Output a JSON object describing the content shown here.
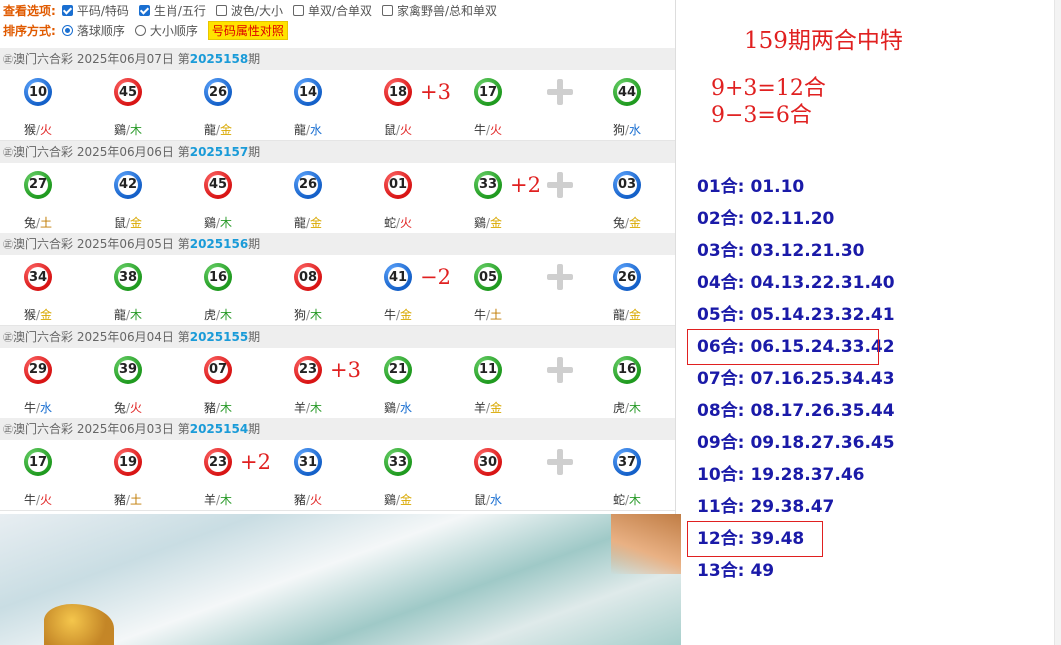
{
  "filters": {
    "view_label": "查看选项:",
    "view_options": [
      {
        "label": "平码/特码",
        "checked": true
      },
      {
        "label": "生肖/五行",
        "checked": true
      },
      {
        "label": "波色/大小",
        "checked": false
      },
      {
        "label": "单双/合单双",
        "checked": false
      },
      {
        "label": "家禽野兽/总和单双",
        "checked": false
      }
    ],
    "sort_label": "排序方式:",
    "sort_options": [
      {
        "label": "落球顺序",
        "selected": true
      },
      {
        "label": "大小顺序",
        "selected": false
      }
    ],
    "attr_button": "号码属性对照"
  },
  "draws": [
    {
      "prefix": "澳门六合彩 2025年06月07日 第",
      "issue": "2025158",
      "suffix": "期",
      "balls": [
        {
          "n": "10",
          "c": "blue"
        },
        {
          "n": "45",
          "c": "red"
        },
        {
          "n": "26",
          "c": "blue"
        },
        {
          "n": "14",
          "c": "blue"
        },
        {
          "n": "18",
          "c": "red"
        },
        {
          "n": "17",
          "c": "green"
        }
      ],
      "special": {
        "n": "44",
        "c": "green"
      },
      "zodiacs": [
        {
          "z": "猴",
          "e": "火",
          "t": "fire"
        },
        {
          "z": "鷄",
          "e": "木",
          "t": "wood"
        },
        {
          "z": "龍",
          "e": "金",
          "t": "gold"
        },
        {
          "z": "龍",
          "e": "水",
          "t": "water"
        },
        {
          "z": "鼠",
          "e": "火",
          "t": "fire"
        },
        {
          "z": "牛",
          "e": "火",
          "t": "fire"
        }
      ],
      "special_zodiac": {
        "z": "狗",
        "e": "水",
        "t": "water"
      },
      "annotation": {
        "text": "+3",
        "after": 4
      }
    },
    {
      "prefix": "澳门六合彩 2025年06月06日 第",
      "issue": "2025157",
      "suffix": "期",
      "balls": [
        {
          "n": "27",
          "c": "green"
        },
        {
          "n": "42",
          "c": "blue"
        },
        {
          "n": "45",
          "c": "red"
        },
        {
          "n": "26",
          "c": "blue"
        },
        {
          "n": "01",
          "c": "red"
        },
        {
          "n": "33",
          "c": "green"
        }
      ],
      "special": {
        "n": "03",
        "c": "blue"
      },
      "zodiacs": [
        {
          "z": "兔",
          "e": "土",
          "t": "earth"
        },
        {
          "z": "鼠",
          "e": "金",
          "t": "gold"
        },
        {
          "z": "鷄",
          "e": "木",
          "t": "wood"
        },
        {
          "z": "龍",
          "e": "金",
          "t": "gold"
        },
        {
          "z": "蛇",
          "e": "火",
          "t": "fire"
        },
        {
          "z": "鷄",
          "e": "金",
          "t": "gold"
        }
      ],
      "special_zodiac": {
        "z": "兔",
        "e": "金",
        "t": "gold"
      },
      "annotation": {
        "text": "+2",
        "after": 5
      }
    },
    {
      "prefix": "澳门六合彩 2025年06月05日 第",
      "issue": "2025156",
      "suffix": "期",
      "balls": [
        {
          "n": "34",
          "c": "red"
        },
        {
          "n": "38",
          "c": "green"
        },
        {
          "n": "16",
          "c": "green"
        },
        {
          "n": "08",
          "c": "red"
        },
        {
          "n": "41",
          "c": "blue"
        },
        {
          "n": "05",
          "c": "green"
        }
      ],
      "special": {
        "n": "26",
        "c": "blue"
      },
      "zodiacs": [
        {
          "z": "猴",
          "e": "金",
          "t": "gold"
        },
        {
          "z": "龍",
          "e": "木",
          "t": "wood"
        },
        {
          "z": "虎",
          "e": "木",
          "t": "wood"
        },
        {
          "z": "狗",
          "e": "木",
          "t": "wood"
        },
        {
          "z": "牛",
          "e": "金",
          "t": "gold"
        },
        {
          "z": "牛",
          "e": "土",
          "t": "earth"
        }
      ],
      "special_zodiac": {
        "z": "龍",
        "e": "金",
        "t": "gold"
      },
      "annotation": {
        "text": "−2",
        "after": 4
      }
    },
    {
      "prefix": "澳门六合彩 2025年06月04日 第",
      "issue": "2025155",
      "suffix": "期",
      "balls": [
        {
          "n": "29",
          "c": "red"
        },
        {
          "n": "39",
          "c": "green"
        },
        {
          "n": "07",
          "c": "red"
        },
        {
          "n": "23",
          "c": "red"
        },
        {
          "n": "21",
          "c": "green"
        },
        {
          "n": "11",
          "c": "green"
        }
      ],
      "special": {
        "n": "16",
        "c": "green"
      },
      "zodiacs": [
        {
          "z": "牛",
          "e": "水",
          "t": "water"
        },
        {
          "z": "兔",
          "e": "火",
          "t": "fire"
        },
        {
          "z": "豬",
          "e": "木",
          "t": "wood"
        },
        {
          "z": "羊",
          "e": "木",
          "t": "wood"
        },
        {
          "z": "鷄",
          "e": "水",
          "t": "water"
        },
        {
          "z": "羊",
          "e": "金",
          "t": "gold"
        }
      ],
      "special_zodiac": {
        "z": "虎",
        "e": "木",
        "t": "wood"
      },
      "annotation": {
        "text": "+3",
        "after": 3
      }
    },
    {
      "prefix": "澳门六合彩 2025年06月03日 第",
      "issue": "2025154",
      "suffix": "期",
      "balls": [
        {
          "n": "17",
          "c": "green"
        },
        {
          "n": "19",
          "c": "red"
        },
        {
          "n": "23",
          "c": "red"
        },
        {
          "n": "31",
          "c": "blue"
        },
        {
          "n": "33",
          "c": "green"
        },
        {
          "n": "30",
          "c": "red"
        }
      ],
      "special": {
        "n": "37",
        "c": "blue"
      },
      "zodiacs": [
        {
          "z": "牛",
          "e": "火",
          "t": "fire"
        },
        {
          "z": "豬",
          "e": "土",
          "t": "earth"
        },
        {
          "z": "羊",
          "e": "木",
          "t": "wood"
        },
        {
          "z": "豬",
          "e": "火",
          "t": "fire"
        },
        {
          "z": "鷄",
          "e": "金",
          "t": "gold"
        },
        {
          "z": "鼠",
          "e": "水",
          "t": "water"
        }
      ],
      "special_zodiac": {
        "z": "蛇",
        "e": "木",
        "t": "wood"
      },
      "annotation": {
        "text": "+2",
        "after": 2
      }
    }
  ],
  "side": {
    "title": "159期两合中特",
    "calc": [
      "9+3=12合",
      "9−3=6合"
    ],
    "he_list": [
      {
        "label": "01合:",
        "nums": "01.10",
        "boxed": false
      },
      {
        "label": "02合:",
        "nums": "02.11.20",
        "boxed": false
      },
      {
        "label": "03合:",
        "nums": "03.12.21.30",
        "boxed": false
      },
      {
        "label": "04合:",
        "nums": "04.13.22.31.40",
        "boxed": false
      },
      {
        "label": "05合:",
        "nums": "05.14.23.32.41",
        "boxed": false
      },
      {
        "label": "06合:",
        "nums": "06.15.24.33.42",
        "boxed": true
      },
      {
        "label": "07合:",
        "nums": "07.16.25.34.43",
        "boxed": false
      },
      {
        "label": "08合:",
        "nums": "08.17.26.35.44",
        "boxed": false
      },
      {
        "label": "09合:",
        "nums": "09.18.27.36.45",
        "boxed": false
      },
      {
        "label": "10合:",
        "nums": "19.28.37.46",
        "boxed": false
      },
      {
        "label": "11合:",
        "nums": "29.38.47",
        "boxed": false
      },
      {
        "label": "12合:",
        "nums": "39.48",
        "boxed": true
      },
      {
        "label": "13合:",
        "nums": "49",
        "boxed": false
      }
    ]
  },
  "icons": {
    "draw_prefix": "clock-icon",
    "plus": "plus-icon"
  }
}
